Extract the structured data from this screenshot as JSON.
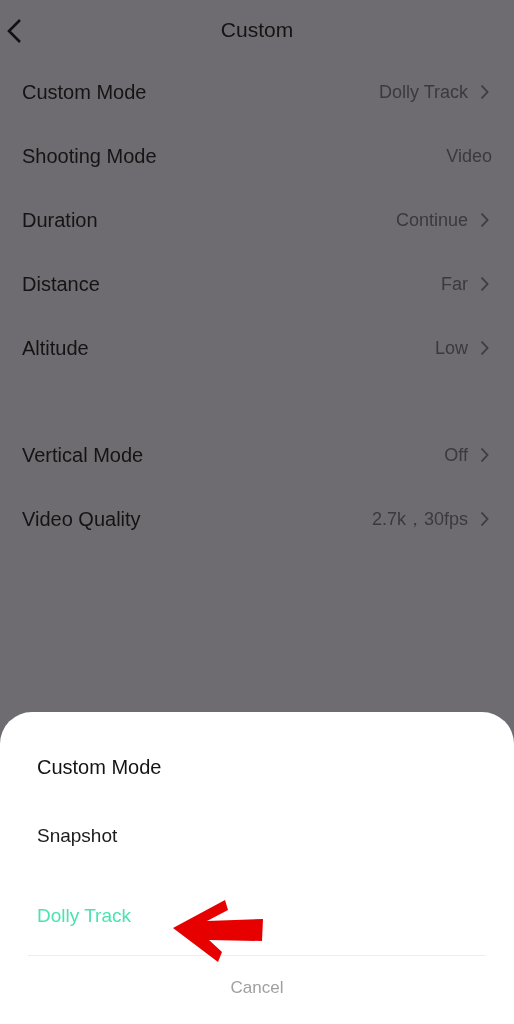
{
  "header": {
    "title": "Custom"
  },
  "settings_groups": [
    {
      "rows": [
        {
          "label": "Custom Mode",
          "value": "Dolly Track",
          "chevron": true
        },
        {
          "label": "Shooting Mode",
          "value": "Video",
          "chevron": false
        },
        {
          "label": "Duration",
          "value": "Continue",
          "chevron": true
        },
        {
          "label": "Distance",
          "value": "Far",
          "chevron": true
        },
        {
          "label": "Altitude",
          "value": "Low",
          "chevron": true
        }
      ]
    },
    {
      "rows": [
        {
          "label": "Vertical Mode",
          "value": "Off",
          "chevron": true
        },
        {
          "label": "Video Quality",
          "value": "2.7k，30fps",
          "chevron": true
        }
      ]
    }
  ],
  "sheet": {
    "title": "Custom Mode",
    "options": [
      {
        "label": "Snapshot",
        "selected": false
      },
      {
        "label": "Dolly Track",
        "selected": true
      }
    ],
    "cancel": "Cancel",
    "annotation": {
      "kind": "arrow"
    }
  }
}
